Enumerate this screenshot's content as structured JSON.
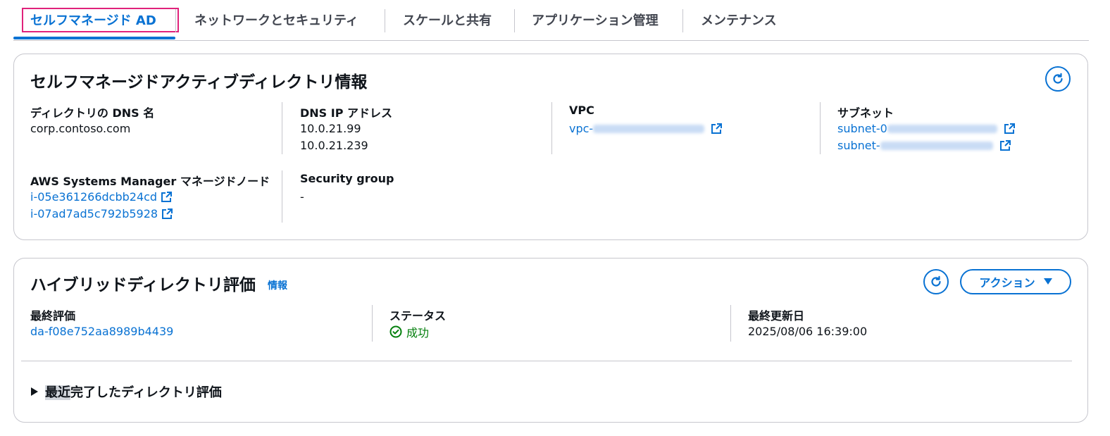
{
  "tabs": [
    {
      "label": "セルフマネージド AD"
    },
    {
      "label": "ネットワークとセキュリティ"
    },
    {
      "label": "スケールと共有"
    },
    {
      "label": "アプリケーション管理"
    },
    {
      "label": "メンテナンス"
    }
  ],
  "directory_info": {
    "title": "セルフマネージドアクティブディレクトリ情報",
    "dns_name": {
      "label": "ディレクトリの DNS 名",
      "value": "corp.contoso.com"
    },
    "dns_ip": {
      "label": "DNS IP アドレス",
      "values": [
        "10.0.21.99",
        "10.0.21.239"
      ]
    },
    "vpc": {
      "label": "VPC",
      "value_prefix": "vpc-"
    },
    "subnet": {
      "label": "サブネット",
      "values": [
        "subnet-0",
        "subnet-"
      ]
    },
    "ssm": {
      "label": "AWS Systems Manager マネージドノード",
      "values": [
        "i-05e361266dcbb24cd",
        "i-07ad7ad5c792b5928"
      ]
    },
    "security_group": {
      "label": "Security group",
      "value": "-"
    }
  },
  "hybrid": {
    "title": "ハイブリッドディレクトリ評価",
    "info_link": "情報",
    "action_label": "アクション",
    "last_assessment": {
      "label": "最終評価",
      "value": "da-f08e752aa8989b4439"
    },
    "status": {
      "label": "ステータス",
      "value": "成功"
    },
    "last_updated": {
      "label": "最終更新日",
      "value": "2025/08/06 16:39:00"
    },
    "expander": {
      "highlight": "最近",
      "rest": "完了したディレクトリ評価"
    }
  },
  "colors": {
    "link": "#0972d3",
    "success": "#037f0c",
    "tab_highlight": "#e0227b"
  }
}
